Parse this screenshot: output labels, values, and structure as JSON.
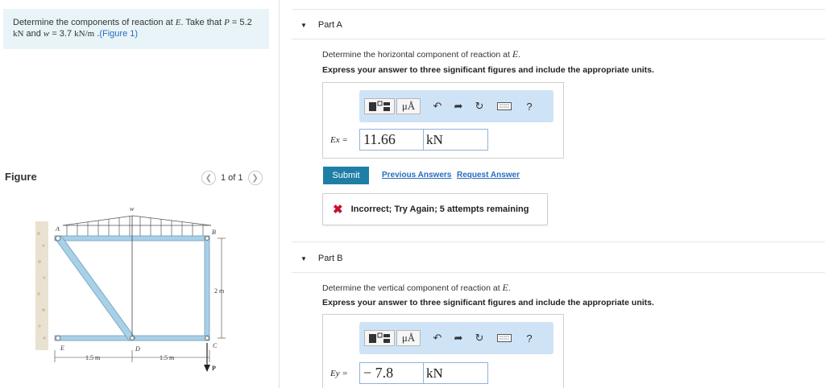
{
  "problem": {
    "line1_pre": "Determine the components of reaction at ",
    "point": "E",
    "line1_mid": ". Take that ",
    "p_var": "P",
    "p_eq": " = 5.2",
    "line2_unit1": "kN",
    "line2_and": " and ",
    "w_var": "w",
    "w_eq": " = 3.7 ",
    "line2_unit2": "kN/m",
    "line2_dot": " .",
    "figure_link": "(Figure 1)"
  },
  "figure": {
    "label": "Figure",
    "pager": "1 of 1",
    "labels": {
      "w": "w",
      "A": "A",
      "B": "B",
      "C": "C",
      "D": "D",
      "E": "E",
      "dim_2m": "2 m",
      "dim_left": "1.5 m",
      "dim_right": "1.5 m",
      "P": "P"
    }
  },
  "partA": {
    "title": "Part A",
    "question_pre": "Determine the horizontal component of reaction at ",
    "question_point": "E",
    "question_post": ".",
    "instruction": "Express your answer to three significant figures and include the appropriate units.",
    "answer_label": "Ex =",
    "answer_value": "11.66",
    "answer_unit": "kN",
    "submit": "Submit",
    "previous_answers": "Previous Answers",
    "request_answer": "Request Answer",
    "feedback": "Incorrect; Try Again; 5 attempts remaining"
  },
  "partB": {
    "title": "Part B",
    "question_pre": "Determine the vertical component of reaction at ",
    "question_point": "E",
    "question_post": ".",
    "instruction": "Express your answer to three significant figures and include the appropriate units.",
    "answer_label": "Ey =",
    "answer_value": "− 7.8",
    "answer_unit": "kN"
  },
  "toolbar": {
    "units_label": "μÅ",
    "help": "?"
  },
  "colors": {
    "accent": "#1f7ea6",
    "link": "#2a6cbf",
    "toolbar_bg": "#cfe3f6",
    "member": "#a8d0e6",
    "error": "#c8102e"
  }
}
